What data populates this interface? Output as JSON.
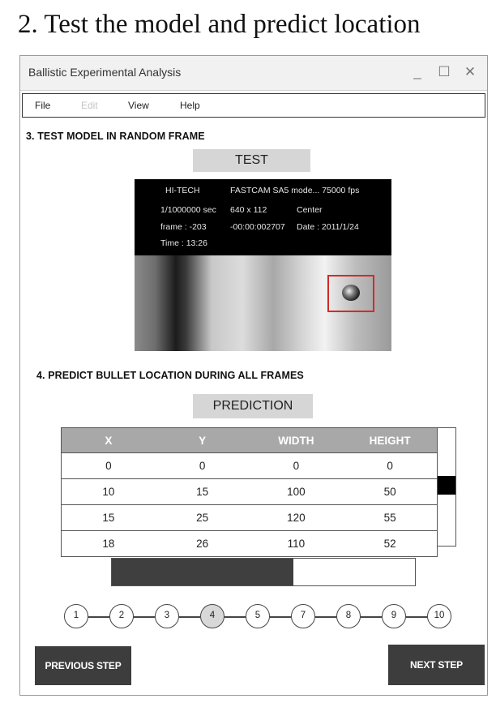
{
  "heading": "2. Test the model and predict location",
  "window": {
    "title": "Ballistic Experimental Analysis",
    "controls": {
      "minimize": "_",
      "maximize": "☐",
      "close": "✕"
    }
  },
  "menu": [
    {
      "label": "File",
      "enabled": true
    },
    {
      "label": "Edit",
      "enabled": false
    },
    {
      "label": "View",
      "enabled": true
    },
    {
      "label": "Help",
      "enabled": true
    }
  ],
  "section3": {
    "title": "3. TEST MODEL IN RANDOM FRAME",
    "button_label": "TEST",
    "frame_info": {
      "brand": "HI-TECH",
      "exposure": "1/1000000 sec",
      "frame": "frame : -203",
      "time": "Time : 13:26",
      "camera": "FASTCAM SA5 mode... 75000 fps",
      "resolution": "640 x 112",
      "timecode": "-00:00:002707",
      "position": "Center",
      "date": "Date : 2011/1/24"
    }
  },
  "section4": {
    "title": "4. PREDICT BULLET LOCATION DURING ALL FRAMES",
    "button_label": "PREDICTION",
    "table": {
      "columns": [
        "X",
        "Y",
        "WIDTH",
        "HEIGHT"
      ],
      "rows": [
        [
          "0",
          "0",
          "0",
          "0"
        ],
        [
          "10",
          "15",
          "100",
          "50"
        ],
        [
          "15",
          "25",
          "120",
          "55"
        ],
        [
          "18",
          "26",
          "110",
          "52"
        ]
      ]
    },
    "progress": 0.6
  },
  "steps": [
    "1",
    "2",
    "3",
    "4",
    "5",
    "7",
    "8",
    "9",
    "10"
  ],
  "active_step": "4",
  "nav": {
    "previous_label": "PREVIOUS STEP",
    "next_label": "NEXT STEP"
  },
  "colors": {
    "detect_box": "#d42a2a",
    "button_gray": "#d6d6d6",
    "header_gray": "#a8a8a8",
    "dark_button": "#3d3d3d"
  }
}
